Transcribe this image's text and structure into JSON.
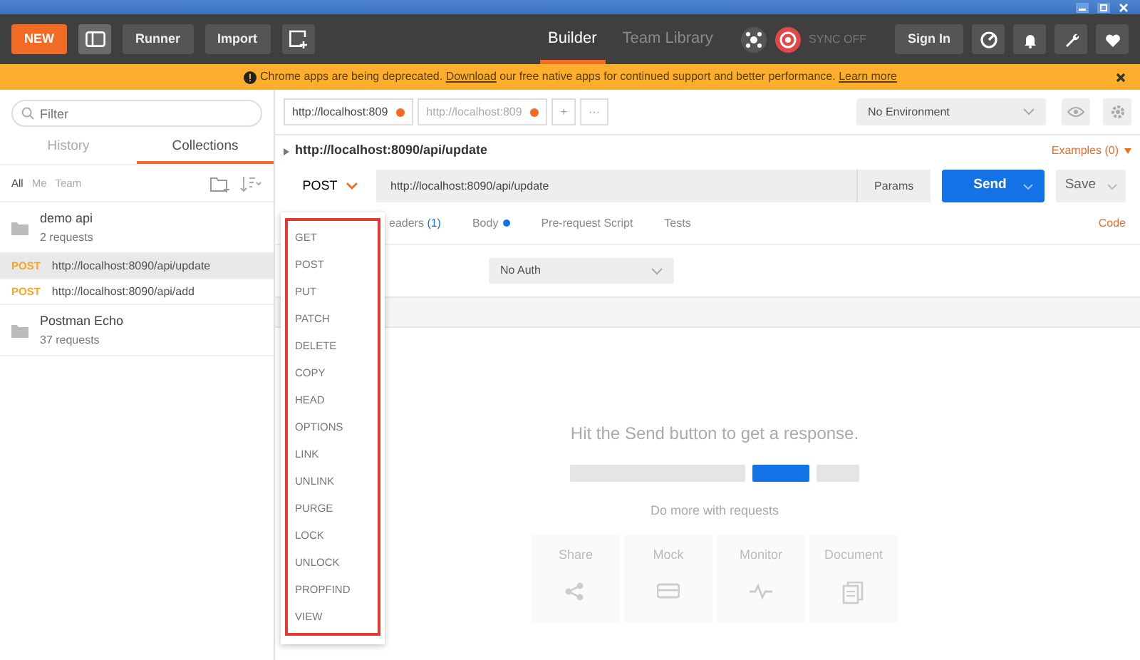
{
  "toolbar": {
    "new_button": "NEW",
    "runner": "Runner",
    "import": "Import",
    "views": [
      {
        "label": "Builder",
        "selected": true
      },
      {
        "label": "Team Library",
        "selected": false
      }
    ],
    "sync": "SYNC OFF",
    "sign_in": "Sign In"
  },
  "banner": {
    "text": "Chrome apps are being deprecated.",
    "link": "Download",
    "text_after": "our free native apps for continued support and better performance.",
    "learn_more": "Learn more"
  },
  "sidebar": {
    "filter_placeholder": "Filter",
    "tabs": [
      {
        "label": "History",
        "selected": false
      },
      {
        "label": "Collections",
        "selected": true
      }
    ],
    "filters": [
      {
        "label": "All",
        "selected": true
      },
      {
        "label": "Me",
        "selected": false
      },
      {
        "label": "Team",
        "selected": false
      }
    ],
    "items": [
      {
        "kind": "collection",
        "name": "demo api",
        "count": "2 requests"
      },
      {
        "kind": "request",
        "method": "POST",
        "url": "http://localhost:8090/api/update",
        "selected": true
      },
      {
        "kind": "request",
        "method": "POST",
        "url": "http://localhost:8090/api/add",
        "selected": false
      },
      {
        "kind": "collection",
        "name": "Postman Echo",
        "count": "37 requests"
      }
    ]
  },
  "request_tabs": [
    {
      "label": "http://localhost:809",
      "selected": true
    },
    {
      "label": "http://localhost:809",
      "selected": false
    }
  ],
  "add_tab": "+",
  "more_tabs": "···",
  "environment": "No Environment",
  "request": {
    "title": "http://localhost:8090/api/update",
    "examples": "Examples (0)",
    "method": "POST",
    "url": "http://localhost:8090/api/update",
    "params": "Params",
    "send": "Send",
    "save": "Save"
  },
  "subtabs": [
    {
      "kind": "count",
      "label": "eaders",
      "count": "(1)"
    },
    {
      "kind": "dot",
      "label": "Body"
    },
    {
      "kind": "plain",
      "label": "Pre-request Script"
    },
    {
      "kind": "plain",
      "label": "Tests"
    }
  ],
  "code": "Code",
  "auth": "No Auth",
  "response": {
    "hint": "Hit the Send button to get a response.",
    "more": "Do more with requests",
    "actions": [
      {
        "kind": "share",
        "label": "Share"
      },
      {
        "kind": "mock",
        "label": "Mock"
      },
      {
        "kind": "monitor",
        "label": "Monitor"
      },
      {
        "kind": "document",
        "label": "Document"
      }
    ]
  },
  "method_menu": [
    "GET",
    "POST",
    "PUT",
    "PATCH",
    "DELETE",
    "COPY",
    "HEAD",
    "OPTIONS",
    "LINK",
    "UNLINK",
    "PURGE",
    "LOCK",
    "UNLOCK",
    "PROPFIND",
    "VIEW"
  ]
}
